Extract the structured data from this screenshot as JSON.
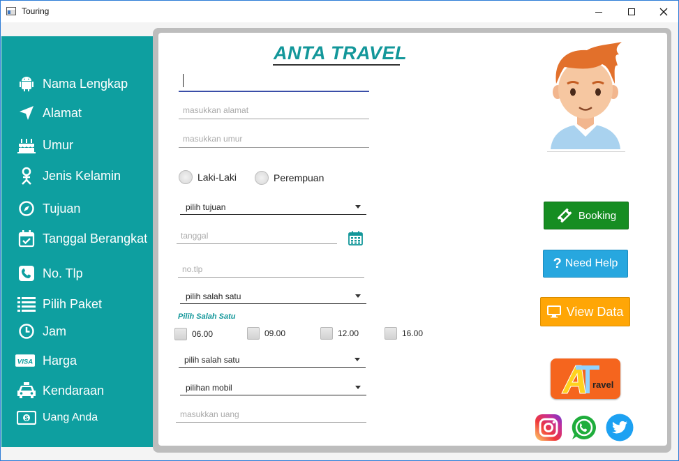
{
  "window": {
    "title": "Touring"
  },
  "brand": {
    "title": "ANTA TRAVEL"
  },
  "sidebar": {
    "items": [
      {
        "label": "Nama Lengkap",
        "icon": "android-icon"
      },
      {
        "label": "Alamat",
        "icon": "location-arrow-icon"
      },
      {
        "label": "Umur",
        "icon": "birthday-cake-icon"
      },
      {
        "label": "Jenis Kelamin",
        "icon": "gender-icon"
      },
      {
        "label": "Tujuan",
        "icon": "compass-icon"
      },
      {
        "label": "Tanggal Berangkat",
        "icon": "calendar-check-icon"
      },
      {
        "label": "No. Tlp",
        "icon": "phone-icon"
      },
      {
        "label": "Pilih Paket",
        "icon": "list-icon"
      },
      {
        "label": "Jam",
        "icon": "clock-icon"
      },
      {
        "label": "Harga",
        "icon": "visa-card-icon"
      },
      {
        "label": "Kendaraan",
        "icon": "taxi-icon"
      },
      {
        "label": "Uang Anda",
        "icon": "money-icon"
      }
    ]
  },
  "form": {
    "nama": {
      "value": "",
      "placeholder": ""
    },
    "alamat": {
      "placeholder": "masukkan alamat"
    },
    "umur": {
      "placeholder": "masukkan umur"
    },
    "gender": {
      "male": "Laki-Laki",
      "female": "Perempuan"
    },
    "tujuan": {
      "selected": "pilih tujuan"
    },
    "tanggal": {
      "placeholder": "tanggal"
    },
    "tlp": {
      "placeholder": "no.tlp"
    },
    "paket": {
      "selected": "pilih salah satu"
    },
    "jam": {
      "label": "Pilih Salah Satu",
      "options": [
        "06.00",
        "09.00",
        "12.00",
        "16.00"
      ]
    },
    "harga": {
      "selected": "pilih salah satu"
    },
    "mobil": {
      "selected": "pilihan mobil"
    },
    "uang": {
      "placeholder": "masukkan uang"
    }
  },
  "actions": {
    "booking": "Booking",
    "help": "Need Help",
    "view": "View Data"
  },
  "logo": {
    "text": "Atravel"
  },
  "social": [
    "instagram-icon",
    "whatsapp-icon",
    "twitter-icon"
  ],
  "colors": {
    "sidebar": "#0e9fa0",
    "brand": "#13979a",
    "booking": "#168d22",
    "help": "#27a7df",
    "view": "#ffa606",
    "logo": "#f5651e"
  }
}
